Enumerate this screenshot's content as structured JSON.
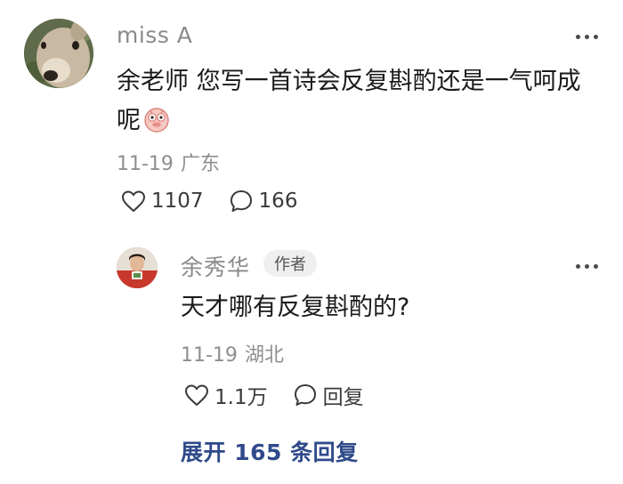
{
  "comment": {
    "username": "miss A",
    "text": "余老师 您写一首诗会反复斟酌还是一气呵成呢",
    "emoji": "pig-face-emoji",
    "date": "11-19",
    "location": "广东",
    "likes": "1107",
    "replies": "166",
    "more_icon": "more-dots-icon"
  },
  "reply": {
    "username": "余秀华",
    "badge": "作者",
    "text": "天才哪有反复斟酌的?",
    "date": "11-19",
    "location": "湖北",
    "likes": "1.1万",
    "reply_label": "回复",
    "more_icon": "more-dots-icon"
  },
  "expand_label": "展开 165 条回复",
  "colors": {
    "link": "#2f4a8a",
    "meta": "#8f8f8f",
    "badge_bg": "#efefef"
  }
}
